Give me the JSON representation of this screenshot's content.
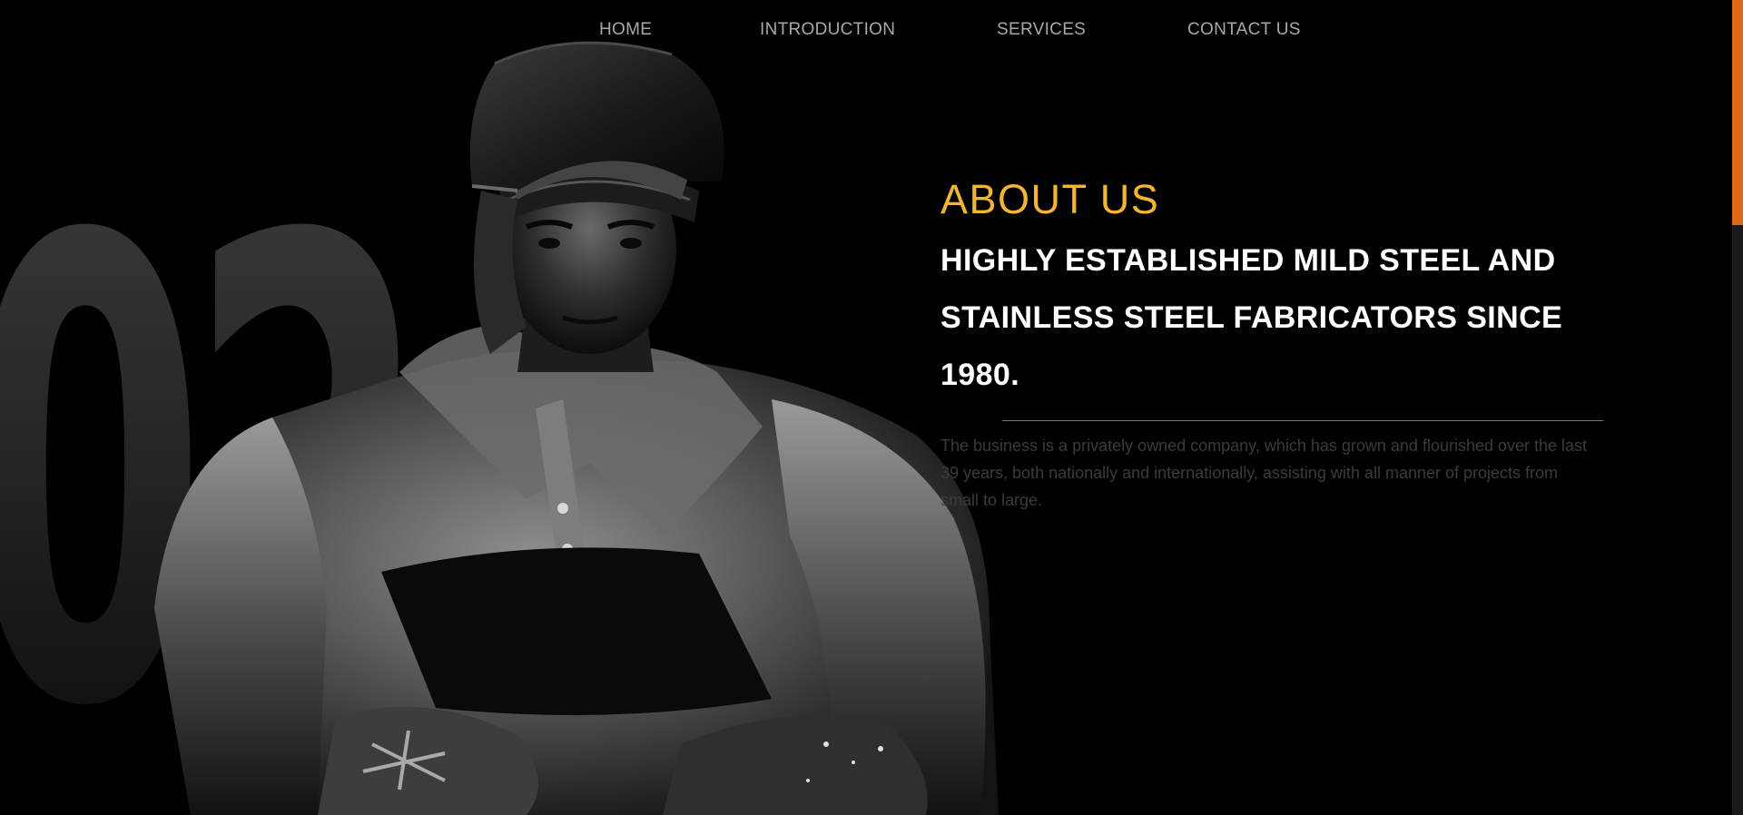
{
  "nav": {
    "items": [
      {
        "label": "HOME"
      },
      {
        "label": "INTRODUCTION"
      },
      {
        "label": "SERVICES"
      },
      {
        "label": "CONTACT US"
      }
    ]
  },
  "section": {
    "number": "02"
  },
  "about": {
    "kicker": "ABOUT US",
    "heading": "HIGHLY ESTABLISHED MILD STEEL AND STAINLESS STEEL FABRICATORS SINCE 1980.",
    "body": "The business is a privately owned company, which has grown and flourished over the last 39 years, both nationally and internationally, assisting with all manner of projects from small to large."
  },
  "hero": {
    "image": "welder-photo"
  },
  "colors": {
    "accent": "#f2b632",
    "divider": "#b7614a",
    "scroll_thumb": "#dd6a16",
    "background": "#000000"
  }
}
